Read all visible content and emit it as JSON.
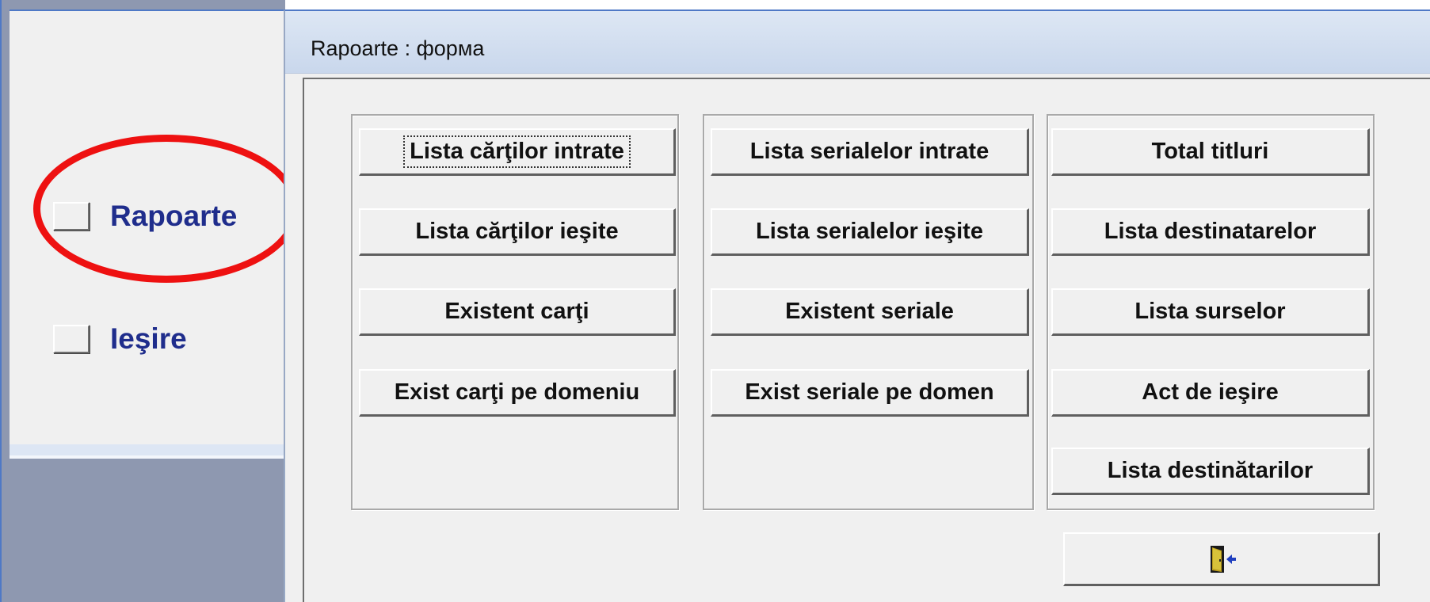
{
  "switchboard": {
    "items": [
      {
        "label": "Rapoarte"
      },
      {
        "label": "Ieşire"
      }
    ]
  },
  "form": {
    "title": "Rapoarte : форма",
    "groups": [
      {
        "buttons": [
          "Lista cărţilor intrate",
          "Lista cărţilor ieşite",
          "Existent carţi",
          "Exist carţi pe domeniu"
        ]
      },
      {
        "buttons": [
          "Lista serialelor intrate",
          "Lista serialelor ieşite",
          "Existent seriale",
          "Exist seriale pe domen"
        ]
      },
      {
        "buttons": [
          "Total titluri",
          "Lista destinatarelor",
          "Lista surselor",
          "Act de ieşire",
          "Lista destinătarilor"
        ]
      }
    ],
    "exit_icon": "exit-door-icon",
    "focused_button": "Lista cărţilor intrate"
  },
  "colors": {
    "highlight": "#ee1111",
    "switchboard_label": "#1f2d8c"
  }
}
